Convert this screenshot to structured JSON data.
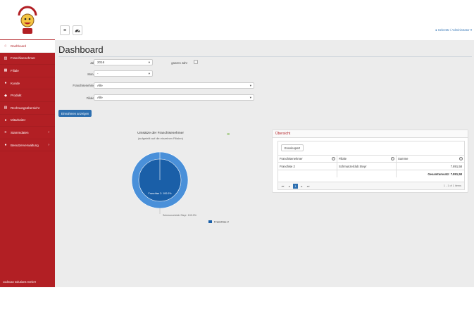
{
  "colors": {
    "brand": "#b21f24",
    "primary": "#2d6fb0",
    "pie_outer": "#4a90d9",
    "pie_inner": "#1a5fa8"
  },
  "sidebar": {
    "items": [
      {
        "label": "Dashboard",
        "icon": "home-icon"
      },
      {
        "label": "Franchisenehmer",
        "icon": "bank-icon"
      },
      {
        "label": "Filiale",
        "icon": "building-icon"
      },
      {
        "label": "Kunde",
        "icon": "users-icon"
      },
      {
        "label": "Produkt",
        "icon": "tag-icon"
      },
      {
        "label": "Rechnungsübersicht",
        "icon": "invoice-icon"
      },
      {
        "label": "Mitarbeiter",
        "icon": "user-icon"
      },
      {
        "label": "Stammdaten",
        "icon": "list-icon"
      },
      {
        "label": "Benutzerverwaltung",
        "icon": "users-cog-icon"
      }
    ],
    "footer": "codecan solutions GmbH"
  },
  "topbar": {
    "user_label": "Sekretär / Administrator ▾"
  },
  "page": {
    "title": "Dashboard"
  },
  "filters": {
    "year_label": "Jahr",
    "year_value": "2016",
    "whole_year_label": "ganzes Jahr",
    "month_label": "Monat",
    "month_value": "-",
    "franchise_label": "Franchisenehmer",
    "franchise_value": "Alle",
    "branch_label": "Filialen",
    "branch_value": "Alle",
    "submit_label": "Einnahmen anzeigen"
  },
  "chart_data": {
    "type": "pie",
    "title": "Umsätze der Franchisenehmer",
    "subtitle": "(aufgeteilt auf die einzelnen Filialen)",
    "inner": {
      "name": "Franchise 2",
      "values": [
        {
          "label": "Franchise 2: 100.0%",
          "value": 100
        }
      ]
    },
    "outer": {
      "values": [
        {
          "label": "Schmunzelclub Steyr: 100.0%",
          "value": 100
        }
      ]
    },
    "legend": [
      "Franchise 2"
    ],
    "legend_position": "bottom"
  },
  "overview": {
    "title": "Übersicht",
    "export_label": "Excelexport",
    "columns": [
      "Franchisenehmer",
      "Filiale",
      "Summe"
    ],
    "rows": [
      [
        "Franchise 2",
        "Schmunzelclub Steyr",
        "7.891,58"
      ]
    ],
    "total_label": "Gesamtumsatz: 7.891,58",
    "page_number": "1",
    "page_info": "1 - 1 of 1 items"
  }
}
